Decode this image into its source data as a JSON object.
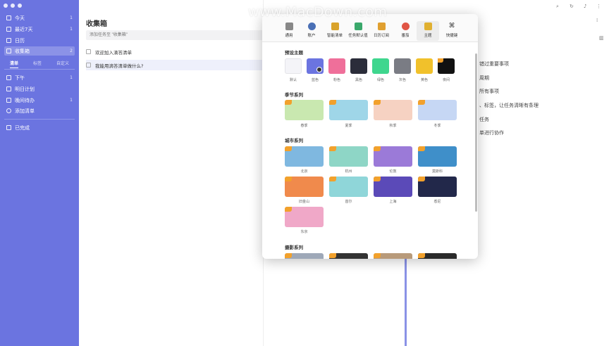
{
  "sidebar": {
    "items_top": [
      {
        "label": "今天",
        "count": "1"
      },
      {
        "label": "最近7天",
        "count": "1"
      },
      {
        "label": "日历",
        "count": ""
      },
      {
        "label": "收集箱",
        "count": "2"
      }
    ],
    "tabs": [
      "清单",
      "标签",
      "自定义"
    ],
    "lists": [
      {
        "label": "下午",
        "count": "1"
      },
      {
        "label": "明日计划",
        "count": ""
      },
      {
        "label": "晚间待办",
        "count": "1"
      },
      {
        "label": "添加清单",
        "count": ""
      }
    ],
    "completed": "已完成"
  },
  "list": {
    "title": "收集箱",
    "add_placeholder": "添加任务至 \"收集箱\"",
    "tasks": [
      "欢迎加入滴答清单",
      "我能用滴答清单做什么?"
    ]
  },
  "detail": {
    "lines": [
      "错过重要事项",
      "周期",
      "所有事项",
      "、标签，让任务清晰有条理",
      "任务",
      "单进行协作"
    ]
  },
  "prefs": {
    "toolbar": [
      {
        "label": "通用",
        "icon": "phone-icon",
        "color": "#888888"
      },
      {
        "label": "账户",
        "icon": "user-icon",
        "color": "#4a6fb5"
      },
      {
        "label": "智能清单",
        "icon": "list-icon",
        "color": "#d9a32b"
      },
      {
        "label": "任务默认值",
        "icon": "task-check-icon",
        "color": "#3aa86b"
      },
      {
        "label": "日历订阅",
        "icon": "calendar-icon",
        "color": "#e0a030"
      },
      {
        "label": "番茄",
        "icon": "tomato-icon",
        "color": "#e05545"
      },
      {
        "label": "主题",
        "icon": "brush-icon",
        "color": "#e0b030"
      },
      {
        "label": "快捷键",
        "icon": "command-icon",
        "color": "#333333"
      }
    ],
    "sections": {
      "preset": "预设主题",
      "season": "季节系列",
      "city": "城市系列",
      "photo": "摄影系列"
    },
    "preset_themes": [
      {
        "label": "默认",
        "color": "#f4f4f8"
      },
      {
        "label": "蓝色",
        "color": "#6b74e0"
      },
      {
        "label": "粉色",
        "color": "#ef6f9a"
      },
      {
        "label": "黑色",
        "color": "#2b2d3a"
      },
      {
        "label": "绿色",
        "color": "#3fd68e"
      },
      {
        "label": "灰色",
        "color": "#7a7c84"
      },
      {
        "label": "黄色",
        "color": "#f1c12b"
      },
      {
        "label": "夜间",
        "color": "#111111"
      }
    ],
    "season_themes": [
      {
        "label": "春季",
        "color": "#c9e8b0"
      },
      {
        "label": "夏季",
        "color": "#9fd6e8"
      },
      {
        "label": "秋季",
        "color": "#f6d2c2"
      },
      {
        "label": "冬季",
        "color": "#c6d7f4"
      }
    ],
    "city_themes": [
      {
        "label": "北京",
        "color": "#7fb8e0"
      },
      {
        "label": "杭州",
        "color": "#8ed6c6"
      },
      {
        "label": "伦敦",
        "color": "#9b7ad8"
      },
      {
        "label": "莫斯科",
        "color": "#3f8fc9"
      },
      {
        "label": "旧金山",
        "color": "#f08a4c"
      },
      {
        "label": "首尔",
        "color": "#8fd6d9"
      },
      {
        "label": "上海",
        "color": "#5b4ab8"
      },
      {
        "label": "悉尼",
        "color": "#22284a"
      },
      {
        "label": "东京",
        "color": "#f0a8c8"
      }
    ],
    "photo_themes": [
      {
        "color": "#9ea8b8"
      },
      {
        "color": "#333333"
      },
      {
        "color": "#b89a7a"
      },
      {
        "color": "#2a2a2a"
      }
    ]
  },
  "watermark": "www.MacDown.com"
}
